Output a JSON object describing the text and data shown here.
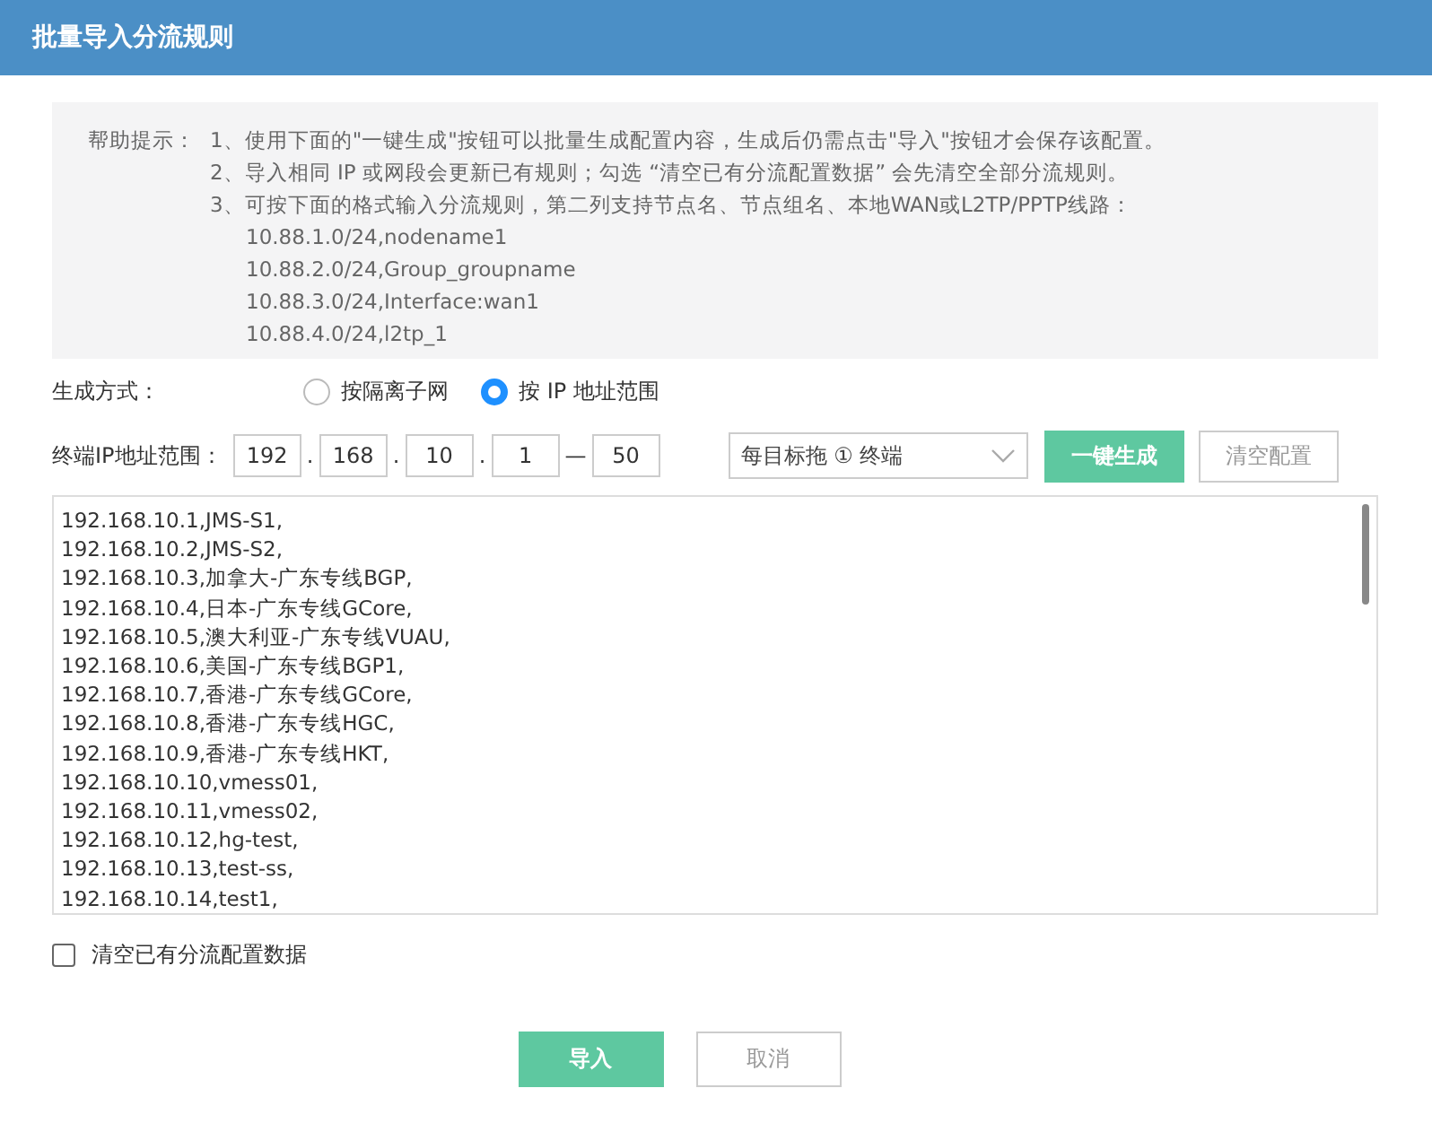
{
  "window": {
    "title": "批量导入分流规则"
  },
  "help": {
    "label": "帮助提示：",
    "items": [
      {
        "text": "1、使用下面的\"一键生成\"按钮可以批量生成配置内容，生成后仍需点击\"导入\"按钮才会保存该配置。"
      },
      {
        "text": "2、导入相同 IP 或网段会更新已有规则；勾选 “清空已有分流配置数据” 会先清空全部分流规则。"
      },
      {
        "text": "3、可按下面的格式输入分流规则，第二列支持节点名、节点组名、本地WAN或L2TP/PPTP线路：",
        "examples": [
          "10.88.1.0/24,nodename1",
          "10.88.2.0/24,Group_groupname",
          "10.88.3.0/24,Interface:wan1",
          "10.88.4.0/24,l2tp_1"
        ]
      }
    ]
  },
  "mode": {
    "label": "生成方式：",
    "options": [
      {
        "label": "按隔离子网",
        "selected": false
      },
      {
        "label": "按 IP 地址范围",
        "selected": true
      }
    ]
  },
  "range": {
    "label": "终端IP地址范围：",
    "octets": [
      "192",
      "168",
      "10",
      "1"
    ],
    "separator": ".",
    "dash": "—",
    "end": "50",
    "select": "每目标拖 ① 终端",
    "generate": "一键生成",
    "clear": "清空配置"
  },
  "rules": [
    "192.168.10.1,JMS-S1,",
    "192.168.10.2,JMS-S2,",
    "192.168.10.3,加拿大-广东专线BGP,",
    "192.168.10.4,日本-广东专线GCore,",
    "192.168.10.5,澳大利亚-广东专线VUAU,",
    "192.168.10.6,美国-广东专线BGP1,",
    "192.168.10.7,香港-广东专线GCore,",
    "192.168.10.8,香港-广东专线HGC,",
    "192.168.10.9,香港-广东专线HKT,",
    "192.168.10.10,vmess01,",
    "192.168.10.11,vmess02,",
    "192.168.10.12,hg-test,",
    "192.168.10.13,test-ss,",
    "192.168.10.14,test1,"
  ],
  "clear_existing": {
    "label": "清空已有分流配置数据",
    "checked": false
  },
  "buttons": {
    "import": "导入",
    "cancel": "取消"
  }
}
